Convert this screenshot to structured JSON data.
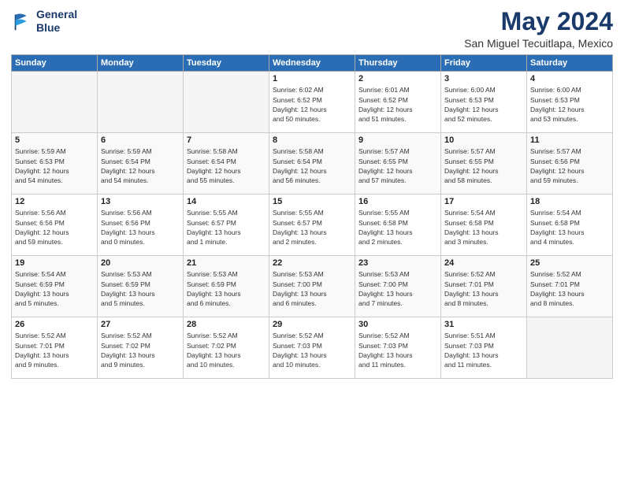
{
  "header": {
    "logo_line1": "General",
    "logo_line2": "Blue",
    "title": "May 2024",
    "subtitle": "San Miguel Tecuitlapa, Mexico"
  },
  "weekdays": [
    "Sunday",
    "Monday",
    "Tuesday",
    "Wednesday",
    "Thursday",
    "Friday",
    "Saturday"
  ],
  "weeks": [
    [
      {
        "day": "",
        "info": ""
      },
      {
        "day": "",
        "info": ""
      },
      {
        "day": "",
        "info": ""
      },
      {
        "day": "1",
        "info": "Sunrise: 6:02 AM\nSunset: 6:52 PM\nDaylight: 12 hours\nand 50 minutes."
      },
      {
        "day": "2",
        "info": "Sunrise: 6:01 AM\nSunset: 6:52 PM\nDaylight: 12 hours\nand 51 minutes."
      },
      {
        "day": "3",
        "info": "Sunrise: 6:00 AM\nSunset: 6:53 PM\nDaylight: 12 hours\nand 52 minutes."
      },
      {
        "day": "4",
        "info": "Sunrise: 6:00 AM\nSunset: 6:53 PM\nDaylight: 12 hours\nand 53 minutes."
      }
    ],
    [
      {
        "day": "5",
        "info": "Sunrise: 5:59 AM\nSunset: 6:53 PM\nDaylight: 12 hours\nand 54 minutes."
      },
      {
        "day": "6",
        "info": "Sunrise: 5:59 AM\nSunset: 6:54 PM\nDaylight: 12 hours\nand 54 minutes."
      },
      {
        "day": "7",
        "info": "Sunrise: 5:58 AM\nSunset: 6:54 PM\nDaylight: 12 hours\nand 55 minutes."
      },
      {
        "day": "8",
        "info": "Sunrise: 5:58 AM\nSunset: 6:54 PM\nDaylight: 12 hours\nand 56 minutes."
      },
      {
        "day": "9",
        "info": "Sunrise: 5:57 AM\nSunset: 6:55 PM\nDaylight: 12 hours\nand 57 minutes."
      },
      {
        "day": "10",
        "info": "Sunrise: 5:57 AM\nSunset: 6:55 PM\nDaylight: 12 hours\nand 58 minutes."
      },
      {
        "day": "11",
        "info": "Sunrise: 5:57 AM\nSunset: 6:56 PM\nDaylight: 12 hours\nand 59 minutes."
      }
    ],
    [
      {
        "day": "12",
        "info": "Sunrise: 5:56 AM\nSunset: 6:56 PM\nDaylight: 12 hours\nand 59 minutes."
      },
      {
        "day": "13",
        "info": "Sunrise: 5:56 AM\nSunset: 6:56 PM\nDaylight: 13 hours\nand 0 minutes."
      },
      {
        "day": "14",
        "info": "Sunrise: 5:55 AM\nSunset: 6:57 PM\nDaylight: 13 hours\nand 1 minute."
      },
      {
        "day": "15",
        "info": "Sunrise: 5:55 AM\nSunset: 6:57 PM\nDaylight: 13 hours\nand 2 minutes."
      },
      {
        "day": "16",
        "info": "Sunrise: 5:55 AM\nSunset: 6:58 PM\nDaylight: 13 hours\nand 2 minutes."
      },
      {
        "day": "17",
        "info": "Sunrise: 5:54 AM\nSunset: 6:58 PM\nDaylight: 13 hours\nand 3 minutes."
      },
      {
        "day": "18",
        "info": "Sunrise: 5:54 AM\nSunset: 6:58 PM\nDaylight: 13 hours\nand 4 minutes."
      }
    ],
    [
      {
        "day": "19",
        "info": "Sunrise: 5:54 AM\nSunset: 6:59 PM\nDaylight: 13 hours\nand 5 minutes."
      },
      {
        "day": "20",
        "info": "Sunrise: 5:53 AM\nSunset: 6:59 PM\nDaylight: 13 hours\nand 5 minutes."
      },
      {
        "day": "21",
        "info": "Sunrise: 5:53 AM\nSunset: 6:59 PM\nDaylight: 13 hours\nand 6 minutes."
      },
      {
        "day": "22",
        "info": "Sunrise: 5:53 AM\nSunset: 7:00 PM\nDaylight: 13 hours\nand 6 minutes."
      },
      {
        "day": "23",
        "info": "Sunrise: 5:53 AM\nSunset: 7:00 PM\nDaylight: 13 hours\nand 7 minutes."
      },
      {
        "day": "24",
        "info": "Sunrise: 5:52 AM\nSunset: 7:01 PM\nDaylight: 13 hours\nand 8 minutes."
      },
      {
        "day": "25",
        "info": "Sunrise: 5:52 AM\nSunset: 7:01 PM\nDaylight: 13 hours\nand 8 minutes."
      }
    ],
    [
      {
        "day": "26",
        "info": "Sunrise: 5:52 AM\nSunset: 7:01 PM\nDaylight: 13 hours\nand 9 minutes."
      },
      {
        "day": "27",
        "info": "Sunrise: 5:52 AM\nSunset: 7:02 PM\nDaylight: 13 hours\nand 9 minutes."
      },
      {
        "day": "28",
        "info": "Sunrise: 5:52 AM\nSunset: 7:02 PM\nDaylight: 13 hours\nand 10 minutes."
      },
      {
        "day": "29",
        "info": "Sunrise: 5:52 AM\nSunset: 7:03 PM\nDaylight: 13 hours\nand 10 minutes."
      },
      {
        "day": "30",
        "info": "Sunrise: 5:52 AM\nSunset: 7:03 PM\nDaylight: 13 hours\nand 11 minutes."
      },
      {
        "day": "31",
        "info": "Sunrise: 5:51 AM\nSunset: 7:03 PM\nDaylight: 13 hours\nand 11 minutes."
      },
      {
        "day": "",
        "info": ""
      }
    ]
  ]
}
